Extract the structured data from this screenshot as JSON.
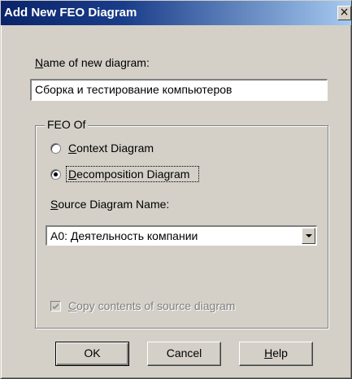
{
  "dialog": {
    "title": "Add New FEO Diagram",
    "close_glyph": "×"
  },
  "name_field": {
    "label_hotkey": "N",
    "label_rest": "ame of new diagram:",
    "value": "Сборка и тестирование компьютеров"
  },
  "feo_group": {
    "legend": "FEO Of",
    "options": [
      {
        "hotkey_pre": "",
        "hotkey": "C",
        "rest": "ontext Diagram",
        "selected": false
      },
      {
        "hotkey_pre": "",
        "hotkey": "D",
        "rest": "ecomposition Diagram",
        "selected": true
      }
    ],
    "source_label_hotkey": "S",
    "source_label_rest": "ource Diagram Name:",
    "source_value": "A0:  Деятельность компании",
    "copy_hotkey": "C",
    "copy_rest": "opy contents of source diagram",
    "copy_checked": true,
    "copy_enabled": false
  },
  "buttons": {
    "ok": "OK",
    "cancel": "Cancel",
    "help_hotkey": "H",
    "help_rest": "elp"
  },
  "icons": {
    "close": "close-icon",
    "dropdown": "chevron-down-icon",
    "check": "checkmark-icon"
  }
}
